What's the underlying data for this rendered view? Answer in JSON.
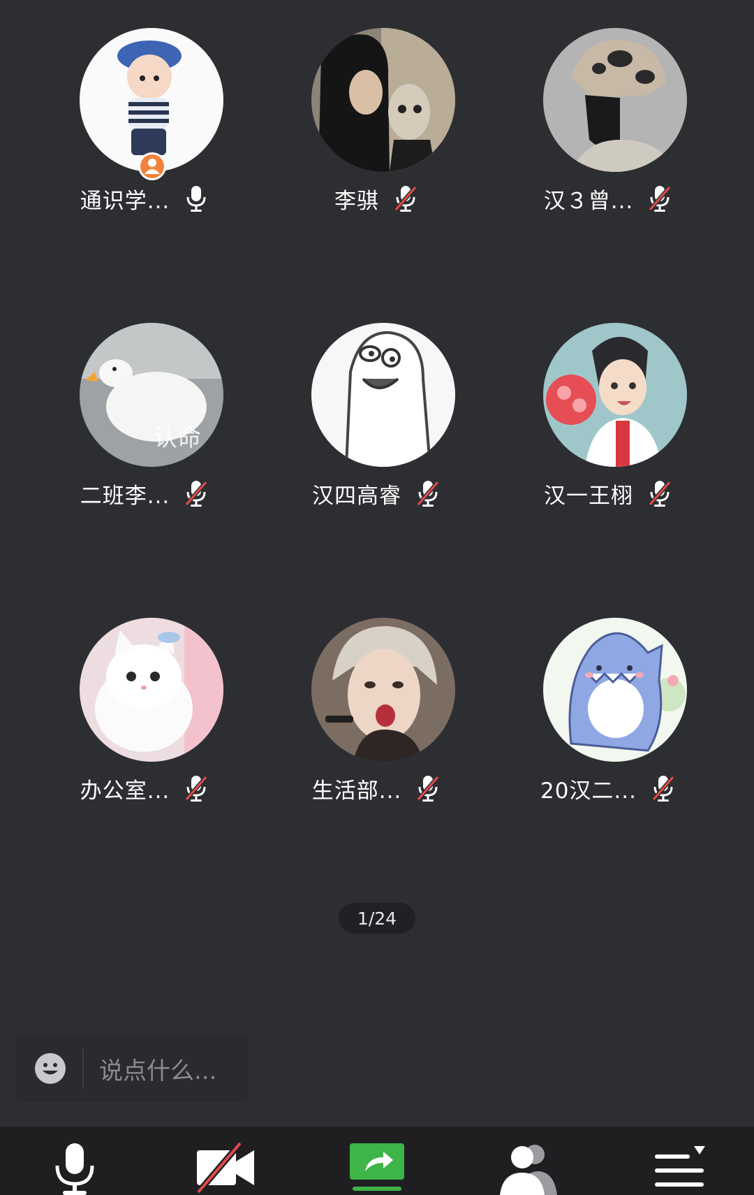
{
  "participants": [
    {
      "name": "通识学...",
      "mic": "on",
      "host": true,
      "avatar": "cartoon-boy-avatar"
    },
    {
      "name": "李骐",
      "mic": "muted",
      "host": false,
      "avatar": "hooded-boy-photo-avatar"
    },
    {
      "name": "汉３曾...",
      "mic": "muted",
      "host": false,
      "avatar": "bucket-hat-photo-avatar"
    },
    {
      "name": "二班李...",
      "mic": "muted",
      "host": false,
      "avatar": "white-goose-avatar"
    },
    {
      "name": "汉四高睿",
      "mic": "muted",
      "host": false,
      "avatar": "sketch-ghost-avatar"
    },
    {
      "name": "汉一王栩",
      "mic": "muted",
      "host": false,
      "avatar": "anime-boy-avatar"
    },
    {
      "name": "办公室...",
      "mic": "muted",
      "host": false,
      "avatar": "white-cat-avatar"
    },
    {
      "name": "生活部...",
      "mic": "muted",
      "host": false,
      "avatar": "singer-photo-avatar"
    },
    {
      "name": "20汉二...",
      "mic": "muted",
      "host": false,
      "avatar": "blue-shark-cartoon-avatar"
    }
  ],
  "avatar_overlay_text": "认命",
  "pager": {
    "text": "1/24"
  },
  "chat": {
    "placeholder": "说点什么..."
  },
  "toolbar": {
    "buttons": [
      "microphone-icon",
      "camera-off-icon",
      "share-screen-icon",
      "participants-icon",
      "more-menu-icon"
    ]
  },
  "colors": {
    "background": "#2d2e32",
    "toolbar": "#1f1f22",
    "muted_slash": "#e24a4a",
    "host_badge": "#f2823a",
    "share_green": "#3fb549"
  }
}
